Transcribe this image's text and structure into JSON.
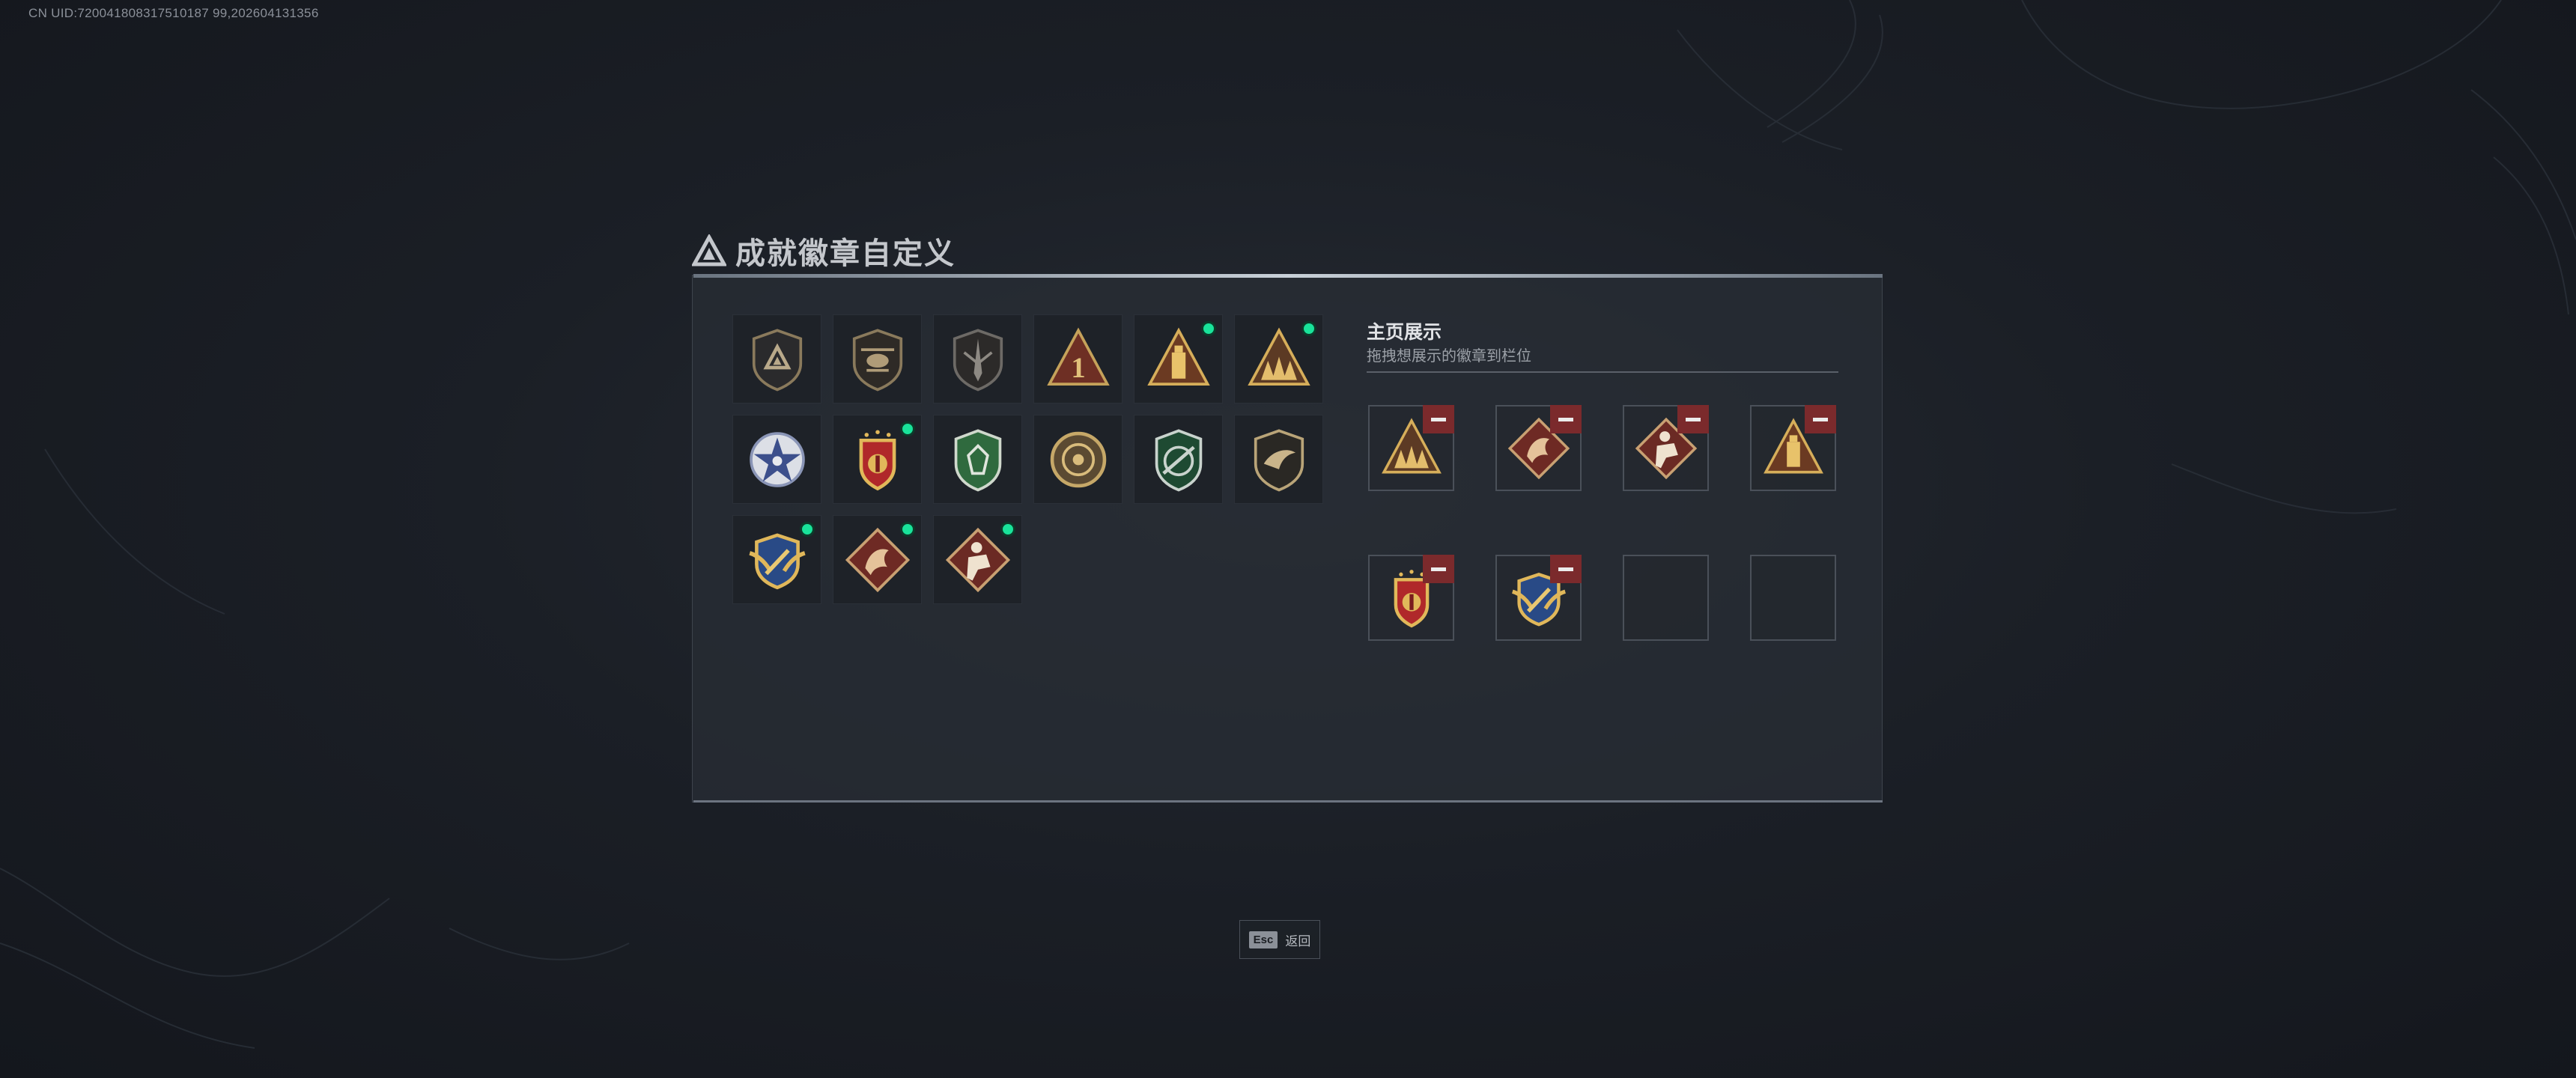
{
  "uid_text": "CN UID:720041808317510187 99,202604131356",
  "title": "成就徽章自定义",
  "showcase": {
    "title": "主页展示",
    "subtitle": "拖拽想展示的徽章到栏位"
  },
  "footer": {
    "esc_key": "Esc",
    "esc_label": "返回"
  },
  "badges": [
    {
      "icon": "shield-triangle-badge-icon",
      "new": false
    },
    {
      "icon": "helicopter-badge-icon",
      "new": false
    },
    {
      "icon": "blade-shield-badge-icon",
      "new": false
    },
    {
      "icon": "number-one-triangle-badge-icon",
      "new": false
    },
    {
      "icon": "tower-triangle-badge-icon",
      "new": true
    },
    {
      "icon": "squad-triangle-badge-icon",
      "new": true
    },
    {
      "icon": "star-wreath-badge-icon",
      "new": false
    },
    {
      "icon": "red-crest-badge-icon",
      "new": true
    },
    {
      "icon": "green-shield-badge-icon",
      "new": false
    },
    {
      "icon": "round-emblem-badge-icon",
      "new": false
    },
    {
      "icon": "rifle-shield-badge-icon",
      "new": false
    },
    {
      "icon": "hawk-shield-badge-icon",
      "new": false
    },
    {
      "icon": "wing-shield-badge-icon",
      "new": true
    },
    {
      "icon": "dragon-diamond-badge-icon",
      "new": true
    },
    {
      "icon": "soldier-diamond-badge-icon",
      "new": true
    }
  ],
  "slots": [
    {
      "icon": "squad-triangle-badge-icon",
      "filled": true
    },
    {
      "icon": "dragon-diamond-badge-icon",
      "filled": true
    },
    {
      "icon": "soldier-diamond-badge-icon",
      "filled": true
    },
    {
      "icon": "tower-triangle-badge-icon",
      "filled": true
    },
    {
      "icon": "red-crest-badge-icon",
      "filled": true
    },
    {
      "icon": "wing-shield-badge-icon",
      "filled": true
    },
    {
      "icon": "",
      "filled": false
    },
    {
      "icon": "",
      "filled": false
    }
  ]
}
